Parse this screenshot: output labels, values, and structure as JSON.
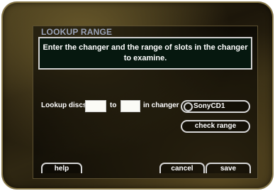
{
  "dialog": {
    "title": "LOOKUP RANGE",
    "message": "Enter the changer and the range of slots in the changer to examine."
  },
  "form": {
    "lookup_label": "Lookup discs",
    "from_value": "",
    "to_label": "to",
    "to_value": "",
    "changer_label": "in changer",
    "changer_value": "SonyCD1",
    "check_range_label": "check range"
  },
  "footer": {
    "help_label": "help",
    "cancel_label": "cancel",
    "save_label": "save"
  }
}
